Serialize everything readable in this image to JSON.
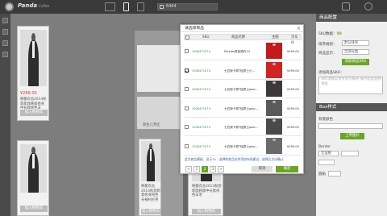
{
  "topbar": {
    "logo": "Panda",
    "logo_sub": "Coffee",
    "page_select_value": "6464"
  },
  "left_column": {
    "products": [
      {
        "price": "¥289.00",
        "title": "韩都衣舍2014秋装新款韩版修身中长款纯色羊",
        "button": "加入购物车"
      },
      {
        "price": "",
        "title": "",
        "button": "加入购物车"
      }
    ]
  },
  "middle_column": {
    "caption": "新生儿专区",
    "products": [
      {
        "title": "韩都衣舍2014秋装新款修身纯色长袖衬衫男",
        "button": "加入购物车"
      },
      {
        "title": "韩都衣舍2014秋装新款韩版中长款纯色羊毛",
        "button": "加入购物车"
      }
    ]
  },
  "right_panel": {
    "header": "商品配置",
    "sku_count_label": "SKU数据：",
    "sku_count": "50",
    "sort_label": "排序规则：",
    "sort_value": "默认排序",
    "style_label": "商品显示：",
    "style_value": "全部分类",
    "add_button": "添加商品SKU",
    "add_sku_label": "添加商品SKU：",
    "add_sku_placeholder": "SKU添加以英文逗号隔开 或点此处选择添加",
    "box_header": "Box样式",
    "bg_color_label": "背景颜色",
    "upload_button": "上传图片",
    "border_label": "Border",
    "border_value": "无边框",
    "radius_label": "圆角"
  },
  "dialog": {
    "title": "请选择商品",
    "close": "×",
    "columns": [
      "SKU",
      "商品名称",
      "主图",
      "京东价"
    ],
    "rows": [
      {
        "checked": false,
        "sku": "1000471074",
        "name": "Dickies男装简约14",
        "price": "¥399.00",
        "thumb": "red-shirt"
      },
      {
        "checked": true,
        "sku": "1000471074",
        "name": "七匹狼卡顿T恤男士小...",
        "price": "¥399.00",
        "thumb": "red-tee"
      },
      {
        "checked": false,
        "sku": "1000471074",
        "name": "七匹狼卡顿T恤男士polo...",
        "price": "¥399.00",
        "thumb": "man-dark"
      },
      {
        "checked": false,
        "sku": "1000471074",
        "name": "七匹狼卡顿T恤男士polo...",
        "price": "¥399.00",
        "thumb": "man-suit"
      },
      {
        "checked": false,
        "sku": "1000471074",
        "name": "七匹狼卡顿T恤男士polo...",
        "price": "¥399.00",
        "thumb": "man-tee"
      },
      {
        "checked": false,
        "sku": "1000471074",
        "name": "七匹狼卡顿T恤男士polo...",
        "price": "¥399.00",
        "thumb": "man-casual"
      }
    ],
    "note": "此为商品模板，显示10 - 选择的商品仅供添加布局建议，选择后点击确认",
    "pagination": [
      "<",
      "1",
      "2",
      "3",
      ">"
    ],
    "current_page": "2",
    "cancel": "取消",
    "confirm": "确定"
  },
  "colors": {
    "accent_green": "#6aa524",
    "price_red": "#e03030",
    "sku_green": "#2a8a3a"
  }
}
